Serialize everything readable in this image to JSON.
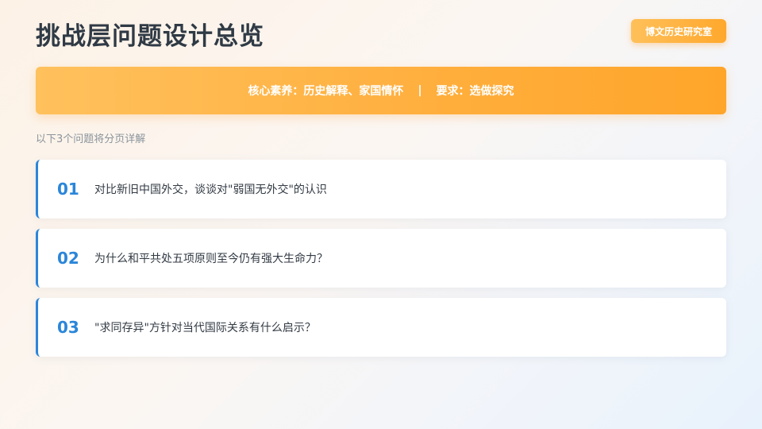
{
  "header": {
    "title": "挑战层问题设计总览",
    "brand": "博文历史研究室"
  },
  "banner": {
    "core": "核心素养：历史解释、家国情怀",
    "separator": "|",
    "requirement": "要求：选做探究"
  },
  "subtitle": "以下3个问题将分页详解",
  "questions": [
    {
      "number": "01",
      "text": "对比新旧中国外交，谈谈对\"弱国无外交\"的认识"
    },
    {
      "number": "02",
      "text": "为什么和平共处五项原则至今仍有强大生命力？"
    },
    {
      "number": "03",
      "text": "\"求同存异\"方针对当代国际关系有什么启示？"
    }
  ],
  "colors": {
    "accent_orange": "#ffa82c",
    "accent_blue": "#2b86d9",
    "title": "#2f3a45"
  }
}
